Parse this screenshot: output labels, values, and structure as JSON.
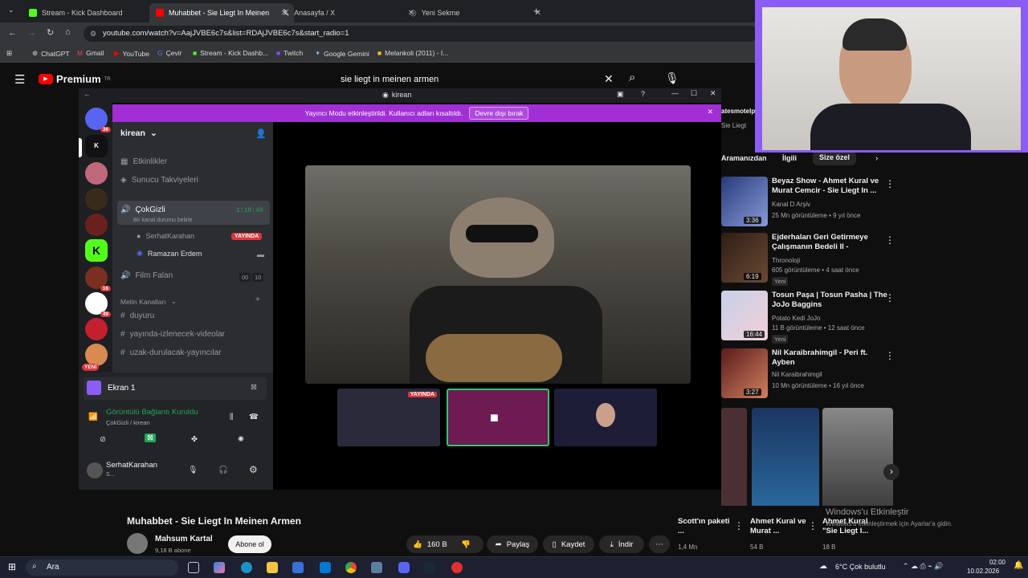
{
  "browser": {
    "tabs": [
      {
        "label": "Stream - Kick Dashboard",
        "color": "#53fc18"
      },
      {
        "label": "Muhabbet - Sie Liegt In Meinen",
        "color": "#ff0000"
      },
      {
        "label": "Anasayfa / X",
        "color": "#ffffff"
      },
      {
        "label": "Yeni Sekme",
        "color": "#9aa0a6"
      }
    ],
    "url": "youtube.com/watch?v=AajJVBE6c7s&list=RDAjJVBE6c7s&start_radio=1",
    "bookmarks": [
      "ChatGPT",
      "Gmail",
      "YouTube",
      "Çevir",
      "Stream - Kick Dashb...",
      "Twitch",
      "Google Gemini",
      "Melankoli (2011) - I..."
    ]
  },
  "youtube": {
    "logo": "Premium",
    "logo_sup": "TR",
    "search_value": "sie liegt in meinen armen",
    "filter_chips": [
      "Aramanızdan",
      "İlgili",
      "Size özel"
    ],
    "video_title": "Muhabbet - Sie Liegt In Meinen Armen",
    "channel_name": "Mahsum Kartal",
    "subscribers": "9,18 B abone",
    "subscribe_label": "Abone ol",
    "likes": "160 B",
    "share_label": "Paylaş",
    "save_label": "Kaydet",
    "download_label": "İndir",
    "partial_title": "atesmotelpr",
    "partial_title2": "Sie Liegt",
    "recommendations": [
      {
        "title": "Beyaz Show - Ahmet Kural ve Murat Cemcir - Sie Liegt In ...",
        "channel": "Kanal D Arşiv",
        "meta": "25 Mn görüntüleme • 9 yıl önce",
        "duration": "3:36",
        "yeni": ""
      },
      {
        "title": "Ejderhaları Geri Getirmeye Çalışmanın Bedeli II -",
        "channel": "Thronoloji",
        "meta": "605 görüntüleme • 4 saat önce",
        "duration": "6:19",
        "yeni": "Yeni"
      },
      {
        "title": "Tosun Paşa | Tosun Pasha | The JoJo Baggins",
        "channel": "Potato Kedi JoJo",
        "meta": "11 B görüntüleme • 12 saat önce",
        "duration": "16:44",
        "yeni": "Yeni"
      },
      {
        "title": "Nil Karaibrahimgil - Peri ft. Ayben",
        "channel": "Nil Karaibrahimgil",
        "meta": "10 Mn görüntüleme • 16 yıl önce",
        "duration": "3:27",
        "yeni": ""
      }
    ],
    "shorts": [
      {
        "title": "Scott'ın paketi ...",
        "views": "1,4 Mn"
      },
      {
        "title": "Ahmet Kural ve Murat ...",
        "views": "54 B"
      },
      {
        "title": "Ahmet Kural \"Sie Liegt I...",
        "views": "18 B"
      }
    ],
    "windows_activation_title": "Windows'u Etkinleştir",
    "windows_activation_sub": "Windows'u etkinleştirmek için Ayarlar'a gidin."
  },
  "discord": {
    "window_title": "kirean",
    "streamer_mode_text": "Yayıncı Modu etkinleştirildi. Kullanıcı adları kısaltıldı.",
    "streamer_mode_button": "Devre dışı bırak",
    "server_name": "kirean",
    "yeni_label": "YENİ",
    "server_badges": [
      "36",
      "16",
      "49"
    ],
    "channels": {
      "activities": "Etkinlikler",
      "boosts": "Sunucu Takviyeleri",
      "voice_active": "ÇokGizli",
      "voice_timer": "1:10:49",
      "voice_status": "Bir kanal durumu belirle",
      "member1": "SerhatKarahan",
      "live_badge": "YAYINDA",
      "member2": "Ramazan Erdem",
      "voice2": "Film Falan",
      "voice2_count_a": "00",
      "voice2_count_b": "10",
      "category": "Metin Kanalları",
      "text1": "duyuru",
      "text2": "yayında-izlenecek-videolar",
      "text3": "uzak-durulacak-yayıncılar"
    },
    "screen_share_label": "Ekran 1",
    "connection_status": "Görüntülü Bağlantı Kuruldu",
    "connection_sub": "ÇokGizli / kirean",
    "username": "SerhatKarahan",
    "user_sub": "S...",
    "tile_live_badge": "YAYINDA"
  },
  "taskbar": {
    "search_label": "Ara",
    "weather": "6°C  Çok bulutlu",
    "time": "02:00",
    "date": "10.02.2026"
  }
}
